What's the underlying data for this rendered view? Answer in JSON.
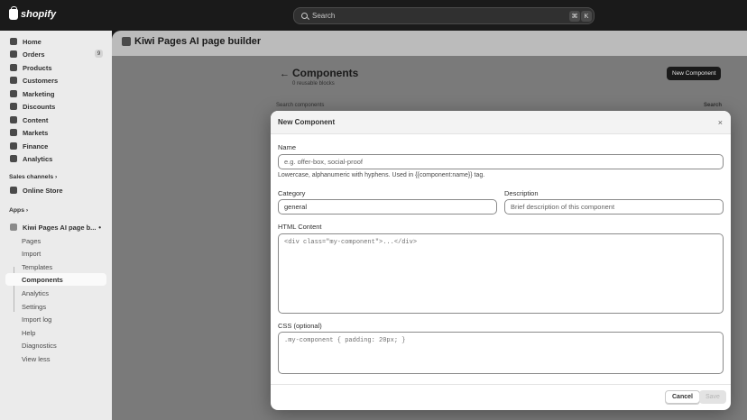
{
  "topbar": {
    "logo_text": "shopify",
    "search_placeholder": "Search",
    "shortcut_cmd": "⌘",
    "shortcut_key": "K"
  },
  "sidebar": {
    "items": [
      {
        "label": "Home",
        "icon": "home-icon"
      },
      {
        "label": "Orders",
        "icon": "orders-icon",
        "badge": "9"
      },
      {
        "label": "Products",
        "icon": "tag-icon"
      },
      {
        "label": "Customers",
        "icon": "person-icon"
      },
      {
        "label": "Marketing",
        "icon": "target-icon"
      },
      {
        "label": "Discounts",
        "icon": "discount-icon"
      },
      {
        "label": "Content",
        "icon": "content-icon"
      },
      {
        "label": "Markets",
        "icon": "globe-icon"
      },
      {
        "label": "Finance",
        "icon": "bank-icon"
      },
      {
        "label": "Analytics",
        "icon": "chart-icon"
      }
    ],
    "sales_channels_label": "Sales channels",
    "online_store": "Online Store",
    "apps_label": "Apps",
    "app_name": "Kiwi Pages AI page b...",
    "app_subitems": [
      "Pages",
      "Import",
      "Templates",
      "Components",
      "Analytics",
      "Settings",
      "Import log",
      "Help",
      "Diagnostics",
      "View less"
    ],
    "active_subitem": "Components"
  },
  "app_header": {
    "title": "Kiwi Pages AI page builder"
  },
  "page": {
    "back_arrow": "←",
    "title": "Components",
    "subtitle": "0 reusable blocks",
    "new_button": "New Component",
    "search_hint": "Search components",
    "search_button": "Search"
  },
  "modal": {
    "title": "New Component",
    "close": "×",
    "name_label": "Name",
    "name_placeholder": "e.g. offer-box, social-proof",
    "name_hint": "Lowercase, alphanumeric with hyphens. Used in {{component:name}} tag.",
    "category_label": "Category",
    "category_value": "general",
    "description_label": "Description",
    "description_placeholder": "Brief description of this component",
    "html_label": "HTML Content",
    "html_placeholder": "<div class=\"my-component\">...</div>",
    "css_label": "CSS (optional)",
    "css_placeholder": ".my-component { padding: 20px; }",
    "cancel": "Cancel",
    "save": "Save"
  },
  "colors": {
    "topbar": "#1a1a1a",
    "sidebar": "#ebebeb",
    "overlay": "#7a7a7a",
    "primary_button": "#1a1a1a"
  }
}
